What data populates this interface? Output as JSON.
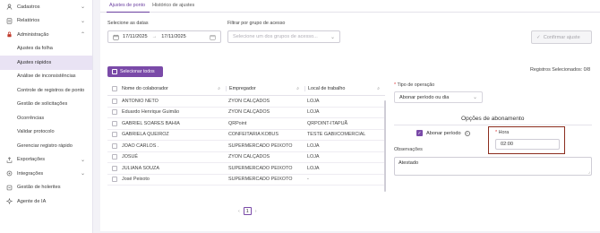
{
  "sidebar": {
    "items": [
      {
        "label": "Cadastros",
        "icon": "person-icon"
      },
      {
        "label": "Relatórios",
        "icon": "report-icon"
      },
      {
        "label": "Administração",
        "icon": "lock-icon"
      }
    ],
    "sub_items": [
      "Ajustes da folha",
      "Ajustes rápidos",
      "Análise de inconsistências",
      "Controle de registros de ponto",
      "Gestão de solicitações",
      "Ocorrências",
      "Validar protocolo",
      "Gerenciar registro rápido"
    ],
    "bottom_items": [
      {
        "label": "Exportações",
        "icon": "export-icon"
      },
      {
        "label": "Integrações",
        "icon": "integration-icon"
      },
      {
        "label": "Gestão de holerites",
        "icon": "payslip-icon"
      },
      {
        "label": "Agente de IA",
        "icon": "ai-agent-icon"
      }
    ]
  },
  "tabs": [
    "Ajustes de ponto",
    "Histórico de ajustes"
  ],
  "filters": {
    "dates_label": "Selecione as datas",
    "date_from": "17/11/2025",
    "date_sep": "→",
    "date_to": "17/11/2025",
    "group_label": "Filtrar por grupo de acesso",
    "group_placeholder": "Selecione um dos grupos de acesso..."
  },
  "actions": {
    "confirm": "Confirmar ajuste",
    "select_all": "Selecionar todos",
    "selected_count": "Registros Selecionados: 0/8"
  },
  "table": {
    "headers": [
      "Nome do colaborador",
      "Empregador",
      "Local de trabalho"
    ],
    "rows": [
      [
        "ANTONIO NETO",
        "ZYON CALÇADOS",
        "LOJA"
      ],
      [
        "Eduardo Henrique Guimão",
        "ZYON CALÇADOS",
        "LOJA"
      ],
      [
        "GABRIEL SOARES BAHIA",
        "QRPoint",
        "QRPOINT-ITAPUÃ"
      ],
      [
        "GABRIELA QUEIROZ",
        "CONFEITARIA KOBUS",
        "TESTE GABI/COMERCIAL"
      ],
      [
        "JOAO CARLOS .",
        "SUPERMERCADO PEIXOTO",
        "LOJA"
      ],
      [
        "JOSUÉ",
        "ZYON CALÇADOS",
        "LOJA"
      ],
      [
        "JULIANA SOUZA",
        "SUPERMERCADO PEIXOTO",
        "LOJA"
      ],
      [
        "José Peixoto",
        "SUPERMERCADO PEIXOTO",
        "-"
      ]
    ],
    "page": "1"
  },
  "operation": {
    "label": "Tipo de operação",
    "value": "Abonar período ou dia"
  },
  "abono": {
    "title": "Opções de abonamento",
    "checkbox_label": "Abonar período",
    "hora_label": "Hora",
    "hora_value": "02:00",
    "obs_label": "Observações",
    "obs_value": "Atestado"
  }
}
